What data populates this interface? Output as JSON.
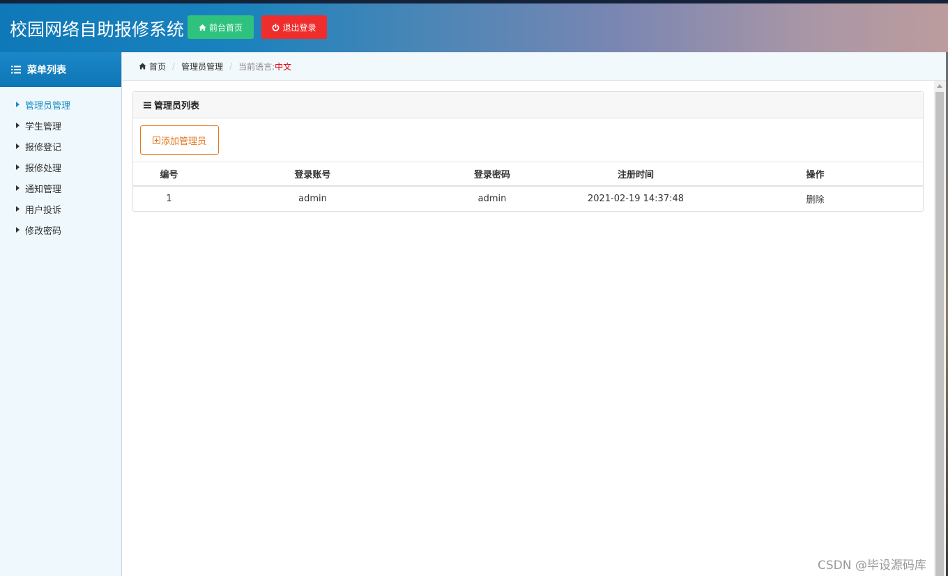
{
  "header": {
    "title": "校园网络自助报修系统",
    "home_label": "前台首页",
    "logout_label": "退出登录",
    "home_color": "#2ec27e",
    "logout_color": "#ef2d2d"
  },
  "sidebar": {
    "title": "菜单列表",
    "items": [
      {
        "label": "管理员管理",
        "active": true
      },
      {
        "label": "学生管理"
      },
      {
        "label": "报修登记"
      },
      {
        "label": "报修处理"
      },
      {
        "label": "通知管理"
      },
      {
        "label": "用户投诉"
      },
      {
        "label": "修改密码"
      }
    ]
  },
  "breadcrumb": {
    "home": "首页",
    "current": "管理员管理",
    "lang_label": "当前语言:",
    "lang_value": "中文"
  },
  "panel": {
    "title": "管理员列表",
    "add_label": "添加管理员",
    "columns": [
      "编号",
      "登录账号",
      "登录密码",
      "注册时间",
      "操作"
    ],
    "rows": [
      [
        "1",
        "admin",
        "admin",
        "2021-02-19 14:37:48",
        "删除"
      ]
    ]
  },
  "watermark": "CSDN @毕设源码库"
}
